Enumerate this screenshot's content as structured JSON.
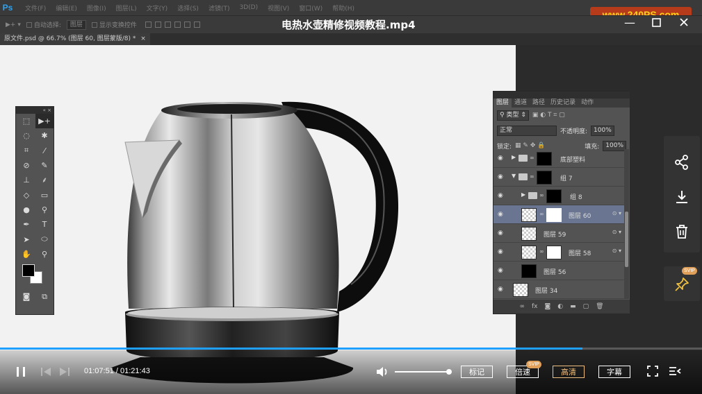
{
  "app": {
    "logo": "Ps"
  },
  "menu": [
    "文件(F)",
    "编辑(E)",
    "图像(I)",
    "图层(L)",
    "文字(Y)",
    "选择(S)",
    "滤镜(T)",
    "3D(D)",
    "视图(V)",
    "窗口(W)",
    "帮助(H)"
  ],
  "watermark": "www.240PS.com",
  "options_bar": {
    "auto_select_label": "自动选择:",
    "auto_select_value": "图层",
    "show_transform_label": "显示变换控件"
  },
  "video": {
    "title": "电热水壶精修视频教程.mp4"
  },
  "document": {
    "tab_label": "原文件.psd @ 66.7% (图层 60, 图层蒙版/8) *"
  },
  "layers_panel": {
    "tabs": [
      "图层",
      "通道",
      "路径",
      "历史记录",
      "动作"
    ],
    "active_tab": "图层",
    "filter_label": "类型",
    "blend_mode": "正常",
    "opacity_label": "不透明度:",
    "opacity_value": "100%",
    "lock_label": "锁定:",
    "fill_label": "填充:",
    "fill_value": "100%",
    "layers": [
      {
        "name": "底部塑料",
        "kind": "group",
        "thumb": "black",
        "indent": 0,
        "selected": false,
        "fx": false
      },
      {
        "name": "组 7",
        "kind": "group-open",
        "thumb": "black",
        "indent": 0,
        "selected": false,
        "fx": false
      },
      {
        "name": "组 8",
        "kind": "group",
        "thumb": "black",
        "indent": 1,
        "selected": false,
        "fx": false
      },
      {
        "name": "图层 60",
        "kind": "layer-mask",
        "thumb": "checker",
        "indent": 1,
        "selected": true,
        "fx": true
      },
      {
        "name": "图层 59",
        "kind": "layer",
        "thumb": "checker",
        "indent": 1,
        "selected": false,
        "fx": true
      },
      {
        "name": "图层 58",
        "kind": "layer-mask",
        "thumb": "checker",
        "indent": 1,
        "selected": false,
        "fx": true
      },
      {
        "name": "图层 56",
        "kind": "layer",
        "thumb": "black",
        "indent": 1,
        "selected": false,
        "fx": false
      },
      {
        "name": "图层 34",
        "kind": "layer",
        "thumb": "checker",
        "indent": 0,
        "selected": false,
        "fx": false
      }
    ]
  },
  "player": {
    "current_time": "01:07:51",
    "separator": "/",
    "total_time": "01:21:43",
    "progress": 0.83,
    "volume": 1.0,
    "buttons": {
      "mark": "标记",
      "speed": "倍速",
      "quality": "高清",
      "subtitle": "字幕"
    },
    "svip_badge": "SVIP",
    "accent_color": "#1fa0ff"
  },
  "side_actions": [
    "share-icon",
    "download-icon",
    "delete-icon",
    "pin-icon"
  ]
}
